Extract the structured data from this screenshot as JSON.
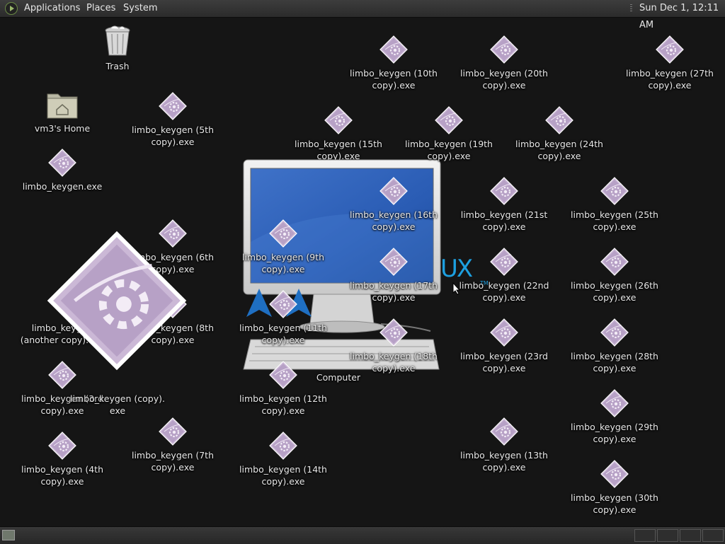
{
  "top_panel": {
    "menus": [
      "Applications",
      "Places",
      "System"
    ],
    "clock": "Sun Dec 1, 12:11 AM"
  },
  "desktop": {
    "trash": {
      "label": "Trash",
      "icon": "trash-icon"
    },
    "home": {
      "label": "vm3's Home",
      "icon": "home-folder-icon"
    },
    "computer": {
      "label": "Computer",
      "icon": "computer-icon"
    },
    "overlay_text": "UX",
    "overlay_tm": "TM",
    "files": [
      "limbo_keygen (5th\ncopy).exe",
      "limbo_keygen.exe",
      "limbo_keygen (6th\ncopy).exe",
      "limbo_keygen (8th\ncopy).exe",
      "limbo_keygen\n(another copy).exe",
      "limbo_keygen (3rd\ncopy).exe",
      "limbo_keygen (copy).\nexe",
      "limbo_keygen (4th\ncopy).exe",
      "limbo_keygen (7th\ncopy).exe",
      "limbo_keygen (10th\ncopy).exe",
      "limbo_keygen (15th\ncopy).exe",
      "limbo_keygen (16th\ncopy).exe",
      "limbo_keygen (9th\ncopy).exe",
      "limbo_keygen (17th\ncopy).exe",
      "limbo_keygen (11th\ncopy).exe",
      "limbo_keygen (18th\ncopy).exe",
      "limbo_keygen (12th\ncopy).exe",
      "limbo_keygen (14th\ncopy).exe",
      "limbo_keygen (20th\ncopy).exe",
      "limbo_keygen (19th\ncopy).exe",
      "limbo_keygen (24th\ncopy).exe",
      "limbo_keygen (21st\ncopy).exe",
      "limbo_keygen (22nd\ncopy).exe",
      "limbo_keygen (23rd\ncopy).exe",
      "limbo_keygen (13th\ncopy).exe",
      "limbo_keygen (27th\ncopy).exe",
      "limbo_keygen (25th\ncopy).exe",
      "limbo_keygen (26th\ncopy).exe",
      "limbo_keygen (28th\ncopy).exe",
      "limbo_keygen (29th\ncopy).exe",
      "limbo_keygen (30th\ncopy).exe"
    ]
  },
  "colors": {
    "desktop_bg": "#151515",
    "exe_icon": "#cbb8d6",
    "accent_blue": "#1d9fdf"
  }
}
